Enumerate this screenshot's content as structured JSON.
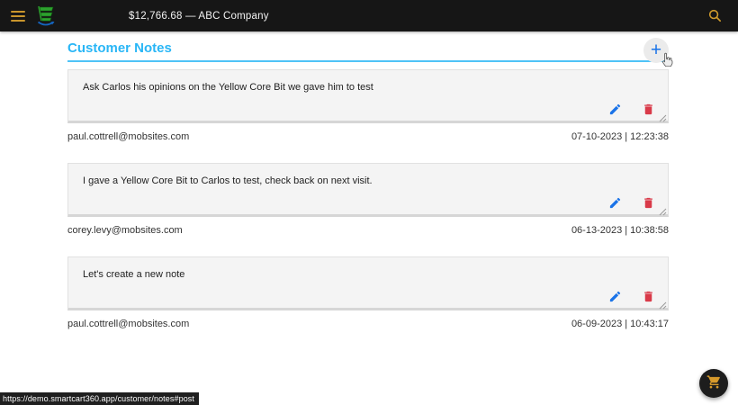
{
  "appbar": {
    "title": "$12,766.68 — ABC Company"
  },
  "page": {
    "heading": "Customer Notes",
    "add_button_label": "+"
  },
  "notes": [
    {
      "text": "Ask Carlos his opinions on the Yellow Core Bit we gave him to test",
      "author": "paul.cottrell@mobsites.com",
      "timestamp": "07-10-2023 | 12:23:38"
    },
    {
      "text": "I gave a Yellow Core Bit to Carlos to test, check back on next visit.",
      "author": "corey.levy@mobsites.com",
      "timestamp": "06-13-2023 | 10:38:58"
    },
    {
      "text": "Let's create a new note",
      "author": "paul.cottrell@mobsites.com",
      "timestamp": "06-09-2023 | 10:43:17"
    }
  ],
  "statusbar": {
    "url": "https://demo.smartcart360.app/customer/notes#post"
  },
  "colors": {
    "heading_blue": "#29b6f6",
    "underline_blue": "#4fc3f7",
    "action_blue": "#1a73e8",
    "danger_red": "#d93a49",
    "amber": "#c9952c",
    "topbar_bg": "#161616",
    "card_bg": "#f4f4f4"
  }
}
